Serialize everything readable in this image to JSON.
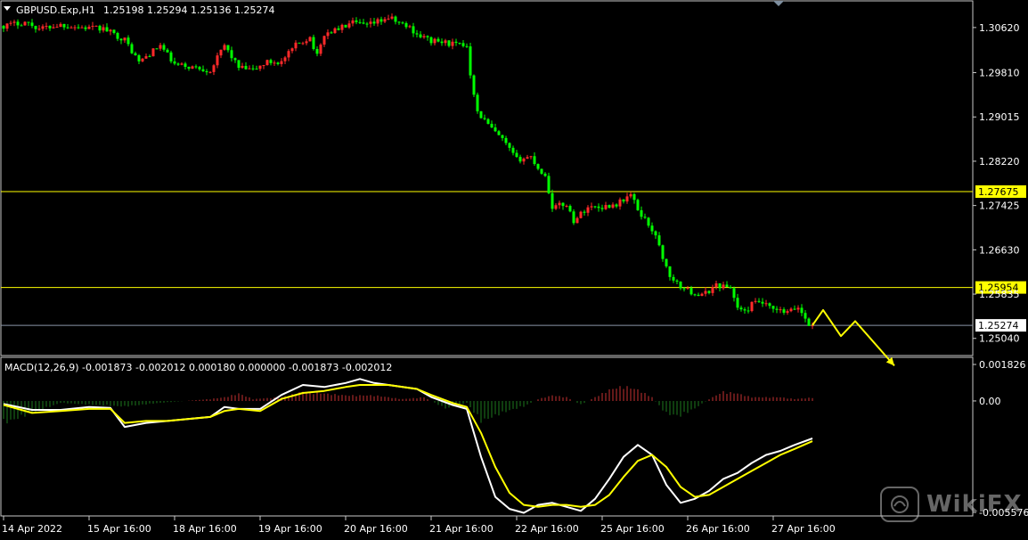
{
  "header": {
    "symbol": "GBPUSD.Exp,H1",
    "ohlc": "1.25198 1.25294 1.25136 1.25274"
  },
  "macd_header": "MACD(12,26,9) -0.001873 -0.002012 0.000180 0.000000 -0.001873 -0.002012",
  "colors": {
    "bull_candle": "#ff2a2a",
    "bear_candle": "#00ff00",
    "level_line": "#ffff00",
    "histogram_pos": "#c83232",
    "histogram_neg": "#1e7a1e",
    "macd_line": "#ffffff",
    "signal_line": "#ffff00",
    "arrow": "#ffff00"
  },
  "icons": [
    "dropdown-triangle-icon",
    "wikifx-logo-icon"
  ],
  "watermark": "WikiFX",
  "chart_data": [
    {
      "type": "candlestick",
      "title": "GBPUSD.Exp,H1",
      "ylim": [
        1.2478,
        1.3105
      ],
      "price_labels": [
        "1.30620",
        "1.29810",
        "1.29015",
        "1.28220",
        "1.27425",
        "1.26630",
        "1.25835",
        "1.25040"
      ],
      "price_label_values": [
        1.3062,
        1.2981,
        1.29015,
        1.2822,
        1.27425,
        1.2663,
        1.25835,
        1.2504
      ],
      "levels": [
        {
          "label": "1.27675",
          "value": 1.27675
        },
        {
          "label": "1.25954",
          "value": 1.25954
        }
      ],
      "current_price": {
        "label": "1.25274",
        "value": 1.25274
      },
      "x_labels": [
        "14 Apr 2022",
        "15 Apr 16:00",
        "18 Apr 16:00",
        "19 Apr 16:00",
        "20 Apr 16:00",
        "21 Apr 16:00",
        "22 Apr 16:00",
        "25 Apr 16:00",
        "26 Apr 16:00",
        "27 Apr 16:00"
      ],
      "x_label_index": [
        0,
        24,
        48,
        72,
        96,
        120,
        144,
        168,
        192,
        216
      ],
      "close_path": [
        [
          0,
          1.3065
        ],
        [
          6,
          1.3072
        ],
        [
          10,
          1.306
        ],
        [
          16,
          1.3067
        ],
        [
          22,
          1.3062
        ],
        [
          28,
          1.306
        ],
        [
          34,
          1.304
        ],
        [
          38,
          1.3
        ],
        [
          42,
          1.302
        ],
        [
          44,
          1.303
        ],
        [
          48,
          1.2995
        ],
        [
          54,
          1.299
        ],
        [
          58,
          1.2985
        ],
        [
          62,
          1.303
        ],
        [
          66,
          1.299
        ],
        [
          70,
          1.2985
        ],
        [
          74,
          1.3
        ],
        [
          78,
          1.3
        ],
        [
          82,
          1.303
        ],
        [
          86,
          1.3045
        ],
        [
          88,
          1.301
        ],
        [
          90,
          1.305
        ],
        [
          94,
          1.306
        ],
        [
          98,
          1.307
        ],
        [
          102,
          1.3065
        ],
        [
          106,
          1.3075
        ],
        [
          108,
          1.308
        ],
        [
          111,
          1.307
        ],
        [
          114,
          1.3062
        ],
        [
          116,
          1.305
        ],
        [
          120,
          1.3038
        ],
        [
          124,
          1.3035
        ],
        [
          128,
          1.303
        ],
        [
          130,
          1.303
        ],
        [
          131,
          1.298
        ],
        [
          133,
          1.291
        ],
        [
          137,
          1.288
        ],
        [
          140,
          1.286
        ],
        [
          144,
          1.2825
        ],
        [
          148,
          1.283
        ],
        [
          150,
          1.281
        ],
        [
          152,
          1.2795
        ],
        [
          154,
          1.274
        ],
        [
          158,
          1.2745
        ],
        [
          160,
          1.2715
        ],
        [
          164,
          1.274
        ],
        [
          168,
          1.274
        ],
        [
          172,
          1.2745
        ],
        [
          176,
          1.2762
        ],
        [
          178,
          1.2735
        ],
        [
          182,
          1.27
        ],
        [
          184,
          1.267
        ],
        [
          186,
          1.263
        ],
        [
          188,
          1.2605
        ],
        [
          192,
          1.259
        ],
        [
          196,
          1.258
        ],
        [
          200,
          1.26
        ],
        [
          204,
          1.2595
        ],
        [
          206,
          1.256
        ],
        [
          208,
          1.255
        ],
        [
          210,
          1.2565
        ],
        [
          212,
          1.257
        ],
        [
          216,
          1.2555
        ],
        [
          220,
          1.255
        ],
        [
          223,
          1.256
        ],
        [
          226,
          1.253
        ],
        [
          227,
          1.25274
        ]
      ],
      "arrow_path": [
        [
          227,
          1.25274
        ],
        [
          230,
          1.2555
        ],
        [
          235,
          1.2508
        ],
        [
          239,
          1.2535
        ],
        [
          250,
          1.2455
        ]
      ]
    },
    {
      "type": "line",
      "title": "MACD(12,26,9)",
      "ylim": [
        -0.005576,
        0.001826
      ],
      "axis_labels": [
        "0.001826",
        "0.00",
        "-0.005576"
      ],
      "axis_label_values": [
        0.001826,
        0.0,
        -0.005576
      ],
      "series": [
        {
          "name": "MACD",
          "points": [
            [
              0,
              -0.00015
            ],
            [
              8,
              -0.00045
            ],
            [
              16,
              -0.00045
            ],
            [
              24,
              -0.0003
            ],
            [
              30,
              -0.00035
            ],
            [
              34,
              -0.0013
            ],
            [
              40,
              -0.0011
            ],
            [
              46,
              -0.001
            ],
            [
              52,
              -0.0009
            ],
            [
              58,
              -0.0008
            ],
            [
              62,
              -0.0003
            ],
            [
              66,
              -0.0004
            ],
            [
              72,
              -0.0004
            ],
            [
              78,
              0.0003
            ],
            [
              84,
              0.0008
            ],
            [
              90,
              0.0007
            ],
            [
              96,
              0.0009
            ],
            [
              100,
              0.0011
            ],
            [
              104,
              0.0009
            ],
            [
              108,
              0.0008
            ],
            [
              112,
              0.0007
            ],
            [
              116,
              0.0006
            ],
            [
              120,
              0.0002
            ],
            [
              126,
              -0.0002
            ],
            [
              130,
              -0.0004
            ],
            [
              134,
              -0.0028
            ],
            [
              138,
              -0.0048
            ],
            [
              142,
              -0.0054
            ],
            [
              146,
              -0.0056
            ],
            [
              150,
              -0.0052
            ],
            [
              154,
              -0.0051
            ],
            [
              158,
              -0.0053
            ],
            [
              162,
              -0.0055
            ],
            [
              166,
              -0.0049
            ],
            [
              170,
              -0.0039
            ],
            [
              174,
              -0.0028
            ],
            [
              178,
              -0.0022
            ],
            [
              182,
              -0.0027
            ],
            [
              186,
              -0.0042
            ],
            [
              190,
              -0.0051
            ],
            [
              194,
              -0.0049
            ],
            [
              198,
              -0.0045
            ],
            [
              202,
              -0.0039
            ],
            [
              206,
              -0.0036
            ],
            [
              210,
              -0.0031
            ],
            [
              214,
              -0.0027
            ],
            [
              218,
              -0.0025
            ],
            [
              222,
              -0.0022
            ],
            [
              227,
              -0.001873
            ]
          ]
        },
        {
          "name": "Signal",
          "points": [
            [
              0,
              -0.0002
            ],
            [
              8,
              -0.0006
            ],
            [
              16,
              -0.0005
            ],
            [
              24,
              -0.0004
            ],
            [
              30,
              -0.0004
            ],
            [
              34,
              -0.0011
            ],
            [
              40,
              -0.001
            ],
            [
              46,
              -0.001
            ],
            [
              52,
              -0.0009
            ],
            [
              58,
              -0.0008
            ],
            [
              62,
              -0.0005
            ],
            [
              66,
              -0.0004
            ],
            [
              72,
              -0.0005
            ],
            [
              78,
              0.0001
            ],
            [
              84,
              0.0004
            ],
            [
              90,
              0.0005
            ],
            [
              96,
              0.0007
            ],
            [
              100,
              0.0008
            ],
            [
              104,
              0.0008
            ],
            [
              108,
              0.0008
            ],
            [
              112,
              0.0007
            ],
            [
              116,
              0.0006
            ],
            [
              120,
              0.0003
            ],
            [
              126,
              -0.0001
            ],
            [
              130,
              -0.0003
            ],
            [
              134,
              -0.0016
            ],
            [
              138,
              -0.0033
            ],
            [
              142,
              -0.0046
            ],
            [
              146,
              -0.0052
            ],
            [
              150,
              -0.0053
            ],
            [
              154,
              -0.0052
            ],
            [
              158,
              -0.0052
            ],
            [
              162,
              -0.0053
            ],
            [
              166,
              -0.0052
            ],
            [
              170,
              -0.0047
            ],
            [
              174,
              -0.0038
            ],
            [
              178,
              -0.003
            ],
            [
              182,
              -0.0027
            ],
            [
              186,
              -0.0033
            ],
            [
              190,
              -0.0043
            ],
            [
              194,
              -0.0048
            ],
            [
              198,
              -0.0047
            ],
            [
              202,
              -0.0043
            ],
            [
              206,
              -0.0039
            ],
            [
              210,
              -0.0035
            ],
            [
              214,
              -0.0031
            ],
            [
              218,
              -0.0027
            ],
            [
              222,
              -0.0024
            ],
            [
              227,
              -0.002012
            ]
          ]
        }
      ],
      "histogram_envelope": [
        [
          0,
          -0.0012
        ],
        [
          16,
          -0.0001
        ],
        [
          24,
          -0.0002
        ],
        [
          34,
          -0.0003
        ],
        [
          44,
          -0.0001
        ],
        [
          58,
          0.0001
        ],
        [
          62,
          0.0002
        ],
        [
          66,
          0.0004
        ],
        [
          70,
          0.0001
        ],
        [
          78,
          0.0002
        ],
        [
          84,
          0.0005
        ],
        [
          90,
          0.0004
        ],
        [
          96,
          0.0003
        ],
        [
          104,
          0.0003
        ],
        [
          112,
          0.0001
        ],
        [
          118,
          0.0002
        ],
        [
          124,
          -0.0004
        ],
        [
          130,
          -0.0001
        ],
        [
          134,
          -0.0011
        ],
        [
          138,
          -0.0008
        ],
        [
          142,
          -0.0005
        ],
        [
          146,
          -0.0003
        ],
        [
          150,
          0.0001
        ],
        [
          154,
          0.0003
        ],
        [
          158,
          0.0002
        ],
        [
          162,
          -0.0002
        ],
        [
          166,
          0.0002
        ],
        [
          170,
          0.0006
        ],
        [
          174,
          0.0008
        ],
        [
          178,
          0.0006
        ],
        [
          182,
          0.0002
        ],
        [
          186,
          -0.0007
        ],
        [
          190,
          -0.0008
        ],
        [
          194,
          -0.0004
        ],
        [
          198,
          0.0001
        ],
        [
          202,
          0.0005
        ],
        [
          206,
          0.0004
        ],
        [
          210,
          0.0002
        ],
        [
          214,
          0.0002
        ],
        [
          218,
          0.0002
        ],
        [
          222,
          0.0001
        ],
        [
          227,
          0.00018
        ]
      ]
    }
  ]
}
